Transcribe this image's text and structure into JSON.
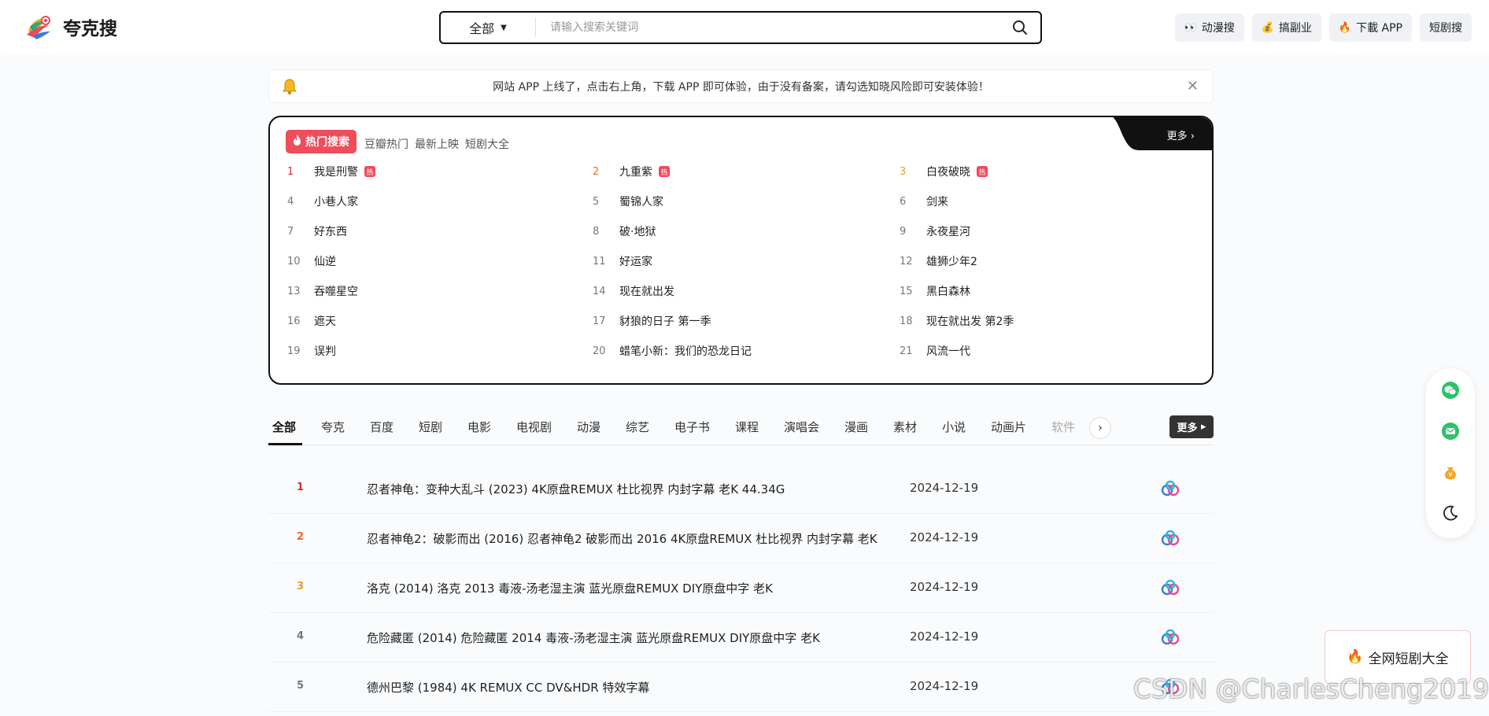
{
  "header": {
    "logo_text": "夸克搜",
    "search": {
      "category": "全部",
      "placeholder": "请输入搜索关键词",
      "value": ""
    },
    "links": [
      {
        "label": "动漫搜",
        "icon": "eyes-icon"
      },
      {
        "label": "搞副业",
        "icon": "money-bag-icon"
      },
      {
        "label": "下載 APP",
        "icon": "fire-icon"
      },
      {
        "label": "短剧搜",
        "icon": ""
      }
    ]
  },
  "notice": {
    "text": "网站 APP 上线了，点击右上角，下载 APP 即可体验，由于没有备案，请勾选知晓风险即可安装体验！"
  },
  "hot": {
    "badge": "热门搜索",
    "tabs": [
      "豆瓣热门",
      "最新上映",
      "短剧大全"
    ],
    "more": "更多",
    "flag": "热",
    "items": [
      {
        "rank": "1",
        "title": "我是刑警",
        "hot": true
      },
      {
        "rank": "2",
        "title": "九重紫",
        "hot": true
      },
      {
        "rank": "3",
        "title": "白夜破晓",
        "hot": true
      },
      {
        "rank": "4",
        "title": "小巷人家",
        "hot": false
      },
      {
        "rank": "5",
        "title": "蜀锦人家",
        "hot": false
      },
      {
        "rank": "6",
        "title": "剑来",
        "hot": false
      },
      {
        "rank": "7",
        "title": "好东西",
        "hot": false
      },
      {
        "rank": "8",
        "title": "破·地狱",
        "hot": false
      },
      {
        "rank": "9",
        "title": "永夜星河",
        "hot": false
      },
      {
        "rank": "10",
        "title": "仙逆",
        "hot": false
      },
      {
        "rank": "11",
        "title": "好运家",
        "hot": false
      },
      {
        "rank": "12",
        "title": "雄狮少年2",
        "hot": false
      },
      {
        "rank": "13",
        "title": "吞噬星空",
        "hot": false
      },
      {
        "rank": "14",
        "title": "现在就出发",
        "hot": false
      },
      {
        "rank": "15",
        "title": "黑白森林",
        "hot": false
      },
      {
        "rank": "16",
        "title": "遮天",
        "hot": false
      },
      {
        "rank": "17",
        "title": "豺狼的日子 第一季",
        "hot": false
      },
      {
        "rank": "18",
        "title": "现在就出发 第2季",
        "hot": false
      },
      {
        "rank": "19",
        "title": "误判",
        "hot": false
      },
      {
        "rank": "20",
        "title": "蜡笔小新：我们的恐龙日记",
        "hot": false
      },
      {
        "rank": "21",
        "title": "风流一代",
        "hot": false
      }
    ]
  },
  "categories": {
    "items": [
      "全部",
      "夸克",
      "百度",
      "短剧",
      "电影",
      "电视剧",
      "动漫",
      "综艺",
      "电子书",
      "课程",
      "演唱会",
      "漫画",
      "素材",
      "小说",
      "动画片",
      "软件"
    ],
    "active": "全部",
    "next_icon": "chevron-right-icon",
    "more": "更多"
  },
  "results": [
    {
      "rank": "1",
      "title": "忍者神龟：变种大乱斗 (2023) 4K原盘REMUX 杜比视界 内封字幕 老K 44.34G",
      "date": "2024-12-19"
    },
    {
      "rank": "2",
      "title": "忍者神龟2：破影而出 (2016) 忍者神龟2 破影而出 2016 4K原盘REMUX 杜比视界 内封字幕 老K",
      "date": "2024-12-19"
    },
    {
      "rank": "3",
      "title": "洛克 (2014) 洛克 2013 毒液-汤老湿主演 蓝光原盘REMUX DIY原盘中字 老K",
      "date": "2024-12-19"
    },
    {
      "rank": "4",
      "title": "危险藏匿 (2014) 危险藏匿 2014 毒液-汤老湿主演 蓝光原盘REMUX DIY原盘中字 老K",
      "date": "2024-12-19"
    },
    {
      "rank": "5",
      "title": "德州巴黎 (1984) 4K REMUX CC DV&HDR 特效字幕",
      "date": "2024-12-19"
    }
  ],
  "sidebar": [
    "wechat-icon",
    "mail-icon",
    "money-bag-icon",
    "moon-icon"
  ],
  "drama_box": {
    "label": "全网短剧大全",
    "icon": "fire-icon"
  },
  "watermark": "CSDN @CharlesCheng2019",
  "colors": {
    "hot_badge": "#ee4d5a",
    "rank1": "#e02b2b",
    "rank2": "#ee6a1d",
    "rank3": "#e7a028",
    "dark": "#111111"
  }
}
